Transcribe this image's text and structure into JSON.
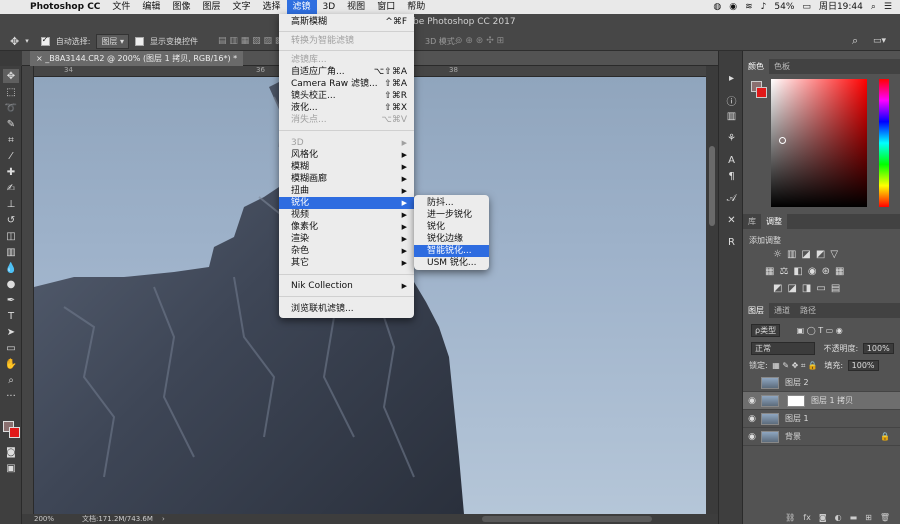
{
  "menubar": {
    "app": "Photoshop CC",
    "items": [
      "文件",
      "编辑",
      "图像",
      "图层",
      "文字",
      "选择",
      "滤镜",
      "3D",
      "视图",
      "窗口",
      "帮助"
    ],
    "active": "滤镜",
    "battery": "54%",
    "clock": "周日19:44"
  },
  "window_title": "be Photoshop CC 2017",
  "options": {
    "auto_select_label": "自动选择:",
    "auto_select_value": "图层",
    "show_transform_label": "显示变换控件",
    "mode_3d_label": "3D 模式:"
  },
  "document": {
    "tab": "_B8A3144.CR2 @ 200% (图层 1 拷贝, RGB/16*) *",
    "ruler_ticks": [
      "34",
      "36",
      "38"
    ],
    "zoom": "200%",
    "doc_size": "文档:171.2M/743.6M"
  },
  "filter_menu": {
    "items": [
      {
        "label": "高斯模糊",
        "shortcut": "^⌘F",
        "enabled": true
      },
      {
        "label": "转换为智能滤镜",
        "enabled": false
      },
      {
        "label": "滤镜库...",
        "enabled": false
      },
      {
        "label": "自适应广角...",
        "shortcut": "⌥⇧⌘A",
        "enabled": true
      },
      {
        "label": "Camera Raw 滤镜...",
        "shortcut": "⇧⌘A",
        "enabled": true
      },
      {
        "label": "镜头校正...",
        "shortcut": "⇧⌘R",
        "enabled": true
      },
      {
        "label": "液化...",
        "shortcut": "⇧⌘X",
        "enabled": true
      },
      {
        "label": "消失点...",
        "shortcut": "⌥⌘V",
        "enabled": false
      },
      {
        "label": "3D",
        "enabled": false,
        "submenu": true
      },
      {
        "label": "风格化",
        "enabled": true,
        "submenu": true
      },
      {
        "label": "模糊",
        "enabled": true,
        "submenu": true
      },
      {
        "label": "模糊画廊",
        "enabled": true,
        "submenu": true
      },
      {
        "label": "扭曲",
        "enabled": true,
        "submenu": true
      },
      {
        "label": "锐化",
        "enabled": true,
        "submenu": true,
        "highlighted": true
      },
      {
        "label": "视频",
        "enabled": true,
        "submenu": true
      },
      {
        "label": "像素化",
        "enabled": true,
        "submenu": true
      },
      {
        "label": "渲染",
        "enabled": true,
        "submenu": true
      },
      {
        "label": "杂色",
        "enabled": true,
        "submenu": true
      },
      {
        "label": "其它",
        "enabled": true,
        "submenu": true
      },
      {
        "label": "Nik Collection",
        "enabled": true,
        "submenu": true
      },
      {
        "label": "浏览联机滤镜...",
        "enabled": true
      }
    ]
  },
  "sharpen_submenu": {
    "items": [
      {
        "label": "防抖..."
      },
      {
        "label": "进一步锐化"
      },
      {
        "label": "锐化"
      },
      {
        "label": "锐化边缘"
      },
      {
        "label": "智能锐化...",
        "highlighted": true
      },
      {
        "label": "USM 锐化..."
      }
    ]
  },
  "color_panel": {
    "tabs": [
      "颜色",
      "色板"
    ],
    "foreground": "#8a7070",
    "background": "#e01919"
  },
  "adjust_panel": {
    "tabs": [
      "库",
      "调整"
    ],
    "label": "添加调整"
  },
  "layers_panel": {
    "tabs": [
      "图层",
      "通道",
      "路径"
    ],
    "filter_kind": "ρ类型",
    "blend_mode": "正常",
    "opacity_label": "不透明度:",
    "opacity": "100%",
    "lock_label": "锁定:",
    "fill_label": "填充:",
    "fill": "100%",
    "layers": [
      {
        "name": "图层 2",
        "visible": false,
        "selected": false,
        "mask": false,
        "locked": false
      },
      {
        "name": "图层 1 拷贝",
        "visible": true,
        "selected": true,
        "mask": true,
        "locked": false
      },
      {
        "name": "图层 1",
        "visible": true,
        "selected": false,
        "mask": false,
        "locked": false
      },
      {
        "name": "背景",
        "visible": true,
        "selected": false,
        "mask": false,
        "locked": true
      }
    ],
    "bottom_buttons": [
      "link-icon",
      "fx-icon",
      "mask-icon",
      "adjustment-icon",
      "folder-icon",
      "new-layer-icon",
      "trash-icon"
    ]
  },
  "colors": {
    "menu_highlight": "#2e6ce0",
    "panel_bg": "#535353",
    "canvas_sky": "#9eb2ca"
  }
}
